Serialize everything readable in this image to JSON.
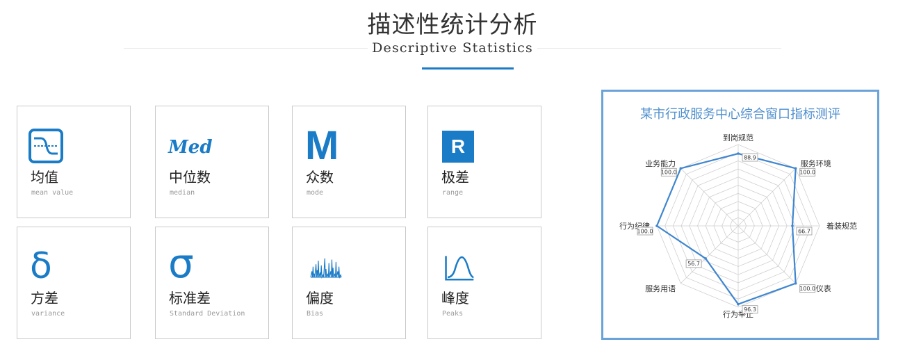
{
  "header": {
    "title": "描述性统计分析",
    "subtitle": "Descriptive Statistics",
    "accent_color": "#1a7bc7"
  },
  "cards": [
    {
      "icon": "sine-wave-icon",
      "zh": "均值",
      "en": "mean value"
    },
    {
      "icon": "med-text-icon",
      "icon_text": "Med",
      "zh": "中位数",
      "en": "median"
    },
    {
      "icon": "letter-m-icon",
      "icon_text": "M",
      "zh": "众数",
      "en": "mode"
    },
    {
      "icon": "letter-r-icon",
      "icon_text": "R",
      "zh": "极差",
      "en": "range"
    },
    {
      "icon": "delta-icon",
      "icon_text": "δ",
      "zh": "方差",
      "en": "variance"
    },
    {
      "icon": "sigma-icon",
      "icon_text": "σ",
      "zh": "标准差",
      "en": "Standard Deviation"
    },
    {
      "icon": "waveform-icon",
      "zh": "偏度",
      "en": "Bias"
    },
    {
      "icon": "bell-curve-icon",
      "zh": "峰度",
      "en": "Peaks"
    }
  ],
  "chart_data": {
    "type": "radar",
    "title": "某市行政服务中心综合窗口指标测评",
    "rmax": 100,
    "rings": 10,
    "axes": [
      "到岗规范",
      "服务环境",
      "着装规范",
      "仪容仪表",
      "行为举止",
      "服务用语",
      "行为纪律",
      "业务能力"
    ],
    "values": [
      88.9,
      100.0,
      66.7,
      100.0,
      96.3,
      56.7,
      100.0,
      100.0
    ],
    "value_labels": [
      "88.9",
      "100.0",
      "66.7",
      "100.0",
      "96.3",
      "56.7",
      "100.0",
      "100.0"
    ],
    "line_color": "#3f86cf",
    "grid_color": "#cfcfcf",
    "border_color": "#6aa3d8"
  }
}
